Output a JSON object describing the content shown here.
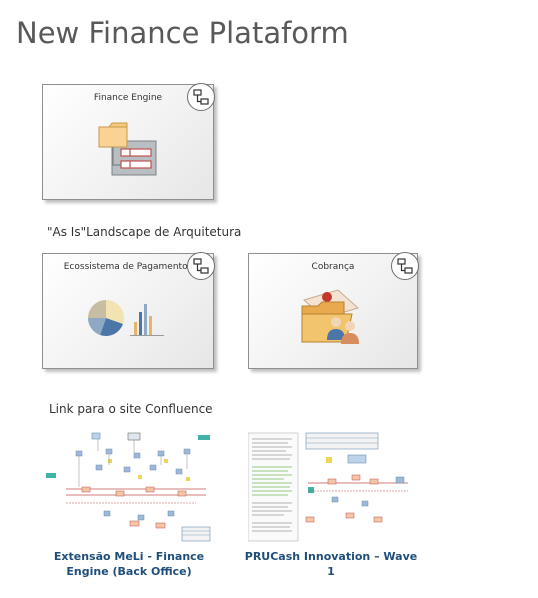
{
  "page": {
    "title": "New Finance Plataform"
  },
  "packages": {
    "finance_engine": {
      "label": "Finance Engine"
    },
    "ecossistema": {
      "label": "Ecossistema de Pagamentos"
    },
    "cobranca": {
      "label": "Cobrança"
    }
  },
  "sections": {
    "as_is": "\"As Is\"Landscape de Arquitetura",
    "confluence": "Link para o site Confluence"
  },
  "thumbnails": [
    {
      "caption_line1": "Extensão MeLi - Finance",
      "caption_line2": "Engine (Back Office)"
    },
    {
      "caption_line1": "PRUCash Innovation – Wave",
      "caption_line2": "1"
    }
  ],
  "icons": {
    "package_link": "diagram-link-icon",
    "finance_engine": "folder-component-icon",
    "ecossistema": "pie-bar-chart-icon",
    "cobranca": "folder-users-icon"
  }
}
